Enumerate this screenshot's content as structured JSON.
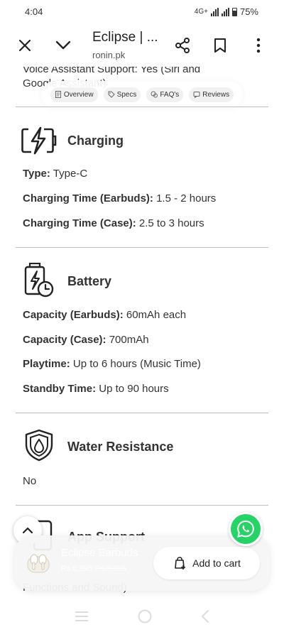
{
  "status": {
    "time": "4:04",
    "network": "4G+",
    "battery": "75%"
  },
  "header": {
    "title": "Eclipse | ...",
    "domain": "ronin.pk"
  },
  "cut_text": {
    "line1": "Voice Assistant Support: Yes (Siri and",
    "line2": "Google Assistant)"
  },
  "chips": [
    {
      "label": "Overview",
      "icon": "document-icon"
    },
    {
      "label": "Specs",
      "icon": "tag-icon"
    },
    {
      "label": "FAQ's",
      "icon": "chat-icon"
    },
    {
      "label": "Reviews",
      "icon": "message-icon"
    }
  ],
  "sections": {
    "charging": {
      "title": "Charging",
      "rows": [
        {
          "key": "Type:",
          "value": " Type-C"
        },
        {
          "key": "Charging Time (Earbuds):",
          "value": " 1.5 - 2 hours"
        },
        {
          "key": "Charging Time (Case):",
          "value": " 2.5 to 3 hours"
        }
      ]
    },
    "battery": {
      "title": "Battery",
      "rows": [
        {
          "key": "Capacity (Earbuds):",
          "value": " 60mAh each"
        },
        {
          "key": "Capacity (Case):",
          "value": " 700mAh"
        },
        {
          "key": "Playtime:",
          "value": " Up to 6 hours (Music Time)"
        },
        {
          "key": "Standby Time:",
          "value": " Up to 90 hours"
        }
      ]
    },
    "water": {
      "title": "Water Resistance",
      "value": "No"
    },
    "app": {
      "title": "App Support",
      "partial": "Functions and Sound)"
    }
  },
  "cart": {
    "product_name": "Eclipse Earbuds",
    "price": "Rs.6,995",
    "old_price": "Rs.9,995",
    "add_label": "Add to cart"
  },
  "colors": {
    "whatsapp": "#25d366",
    "divider": "#bdbdbd"
  }
}
